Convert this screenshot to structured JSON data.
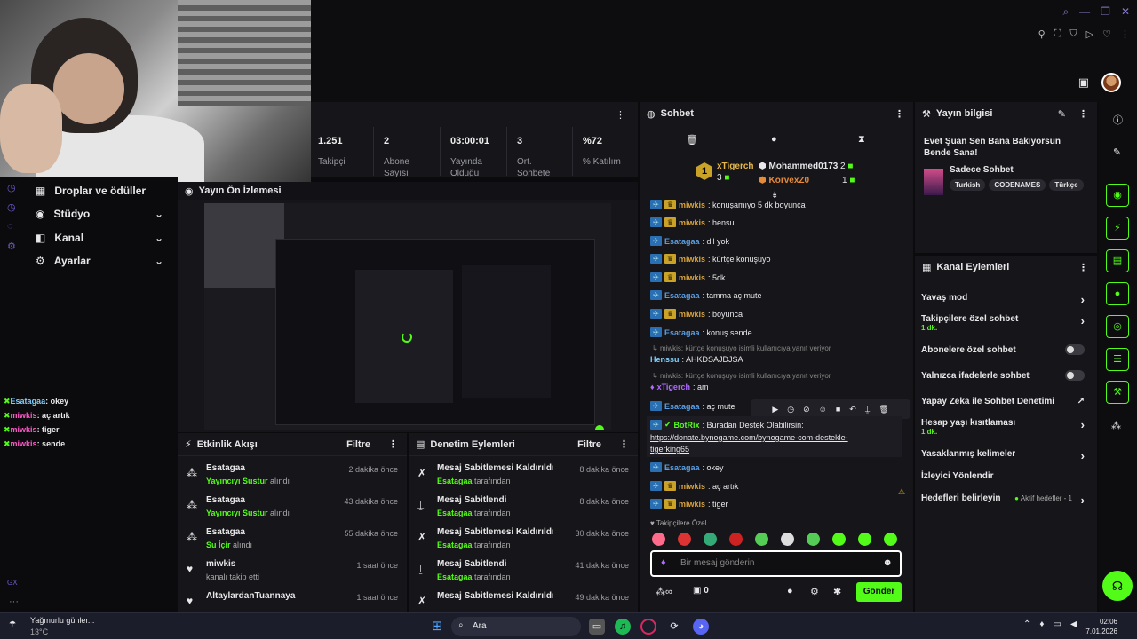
{
  "stats": [
    {
      "value": "1.251",
      "label": "Takipçi"
    },
    {
      "value": "2",
      "label": "Abone Sayısı"
    },
    {
      "value": "03:00:01",
      "label": "Yayında Olduğu"
    },
    {
      "value": "3",
      "label": "Ort. Sohbete"
    },
    {
      "value": "%72",
      "label": "% Katılım"
    }
  ],
  "nav": [
    {
      "label": "Droplar ve ödüller"
    },
    {
      "label": "Stüdyo"
    },
    {
      "label": "Kanal"
    },
    {
      "label": "Ayarlar"
    }
  ],
  "overlay_chat": [
    {
      "user": "Esatagaa",
      "text": ": okey"
    },
    {
      "user": "miwkis",
      "text": ": aç artık"
    },
    {
      "user": "miwkis",
      "text": ": tiger"
    },
    {
      "user": "miwkis",
      "text": ": sende"
    }
  ],
  "preview": {
    "title": "Yayın Ön İzlemesi"
  },
  "activity": {
    "title": "Etkinlik Akışı",
    "filter": "Filtre",
    "items": [
      {
        "user": "Esatagaa",
        "action_hl": "Yayıncıyı Sustur",
        "action": " alındı",
        "time": "2 dakika önce"
      },
      {
        "user": "Esatagaa",
        "action_hl": "Yayıncıyı Sustur",
        "action": " alındı",
        "time": "43 dakika önce"
      },
      {
        "user": "Esatagaa",
        "action_hl": "Su İçir",
        "action": " alındı",
        "time": "55 dakika önce"
      },
      {
        "user": "miwkis",
        "action_hl": "",
        "action": "kanalı takip etti",
        "time": "1 saat önce"
      },
      {
        "user": "AltaylardanTuannaya",
        "action_hl": "",
        "action": "",
        "time": "1 saat önce"
      }
    ]
  },
  "moderation": {
    "title": "Denetim Eylemleri",
    "filter": "Filtre",
    "items": [
      {
        "title": "Mesaj Sabitlemesi Kaldırıldı",
        "by": "Esatagaa",
        "suffix": " tarafından",
        "time": "8 dakika önce"
      },
      {
        "title": "Mesaj Sabitlendi",
        "by": "Esatagaa",
        "suffix": " tarafından",
        "time": "8 dakika önce"
      },
      {
        "title": "Mesaj Sabitlemesi Kaldırıldı",
        "by": "Esatagaa",
        "suffix": " tarafından",
        "time": "30 dakika önce"
      },
      {
        "title": "Mesaj Sabitlendi",
        "by": "Esatagaa",
        "suffix": " tarafından",
        "time": "41 dakika önce"
      },
      {
        "title": "Mesaj Sabitlemesi Kaldırıldı",
        "by": "",
        "suffix": "",
        "time": "49 dakika önce"
      }
    ]
  },
  "chat": {
    "title": "Sohbet",
    "leaders": {
      "first": "xTigerch",
      "first_count": "3",
      "second": "Mohammed0173",
      "second_count": "2",
      "third": "KorvexZ0",
      "third_count": "1",
      "rank": "1"
    },
    "messages": [
      {
        "user": "miwkis",
        "text": ": konuşamıyo 5 dk boyunca"
      },
      {
        "user": "miwkis",
        "text": ": hensu"
      },
      {
        "user": "Esatagaa",
        "text": ": dil yok"
      },
      {
        "user": "miwkis",
        "text": ": kürtçe konuşuyo"
      },
      {
        "user": "miwkis",
        "text": ": 5dk"
      },
      {
        "user": "Esatagaa",
        "text": ": tamma aç mute"
      },
      {
        "user": "miwkis",
        "text": ": boyunca"
      },
      {
        "user": "Esatagaa",
        "text": ": konuş sende"
      }
    ],
    "reply1": "miwkis: kürtçe konuşuyo isimli kullanıcıya yanıt veriyor",
    "reply1_user": "Henssu",
    "reply1_text": ": AHKDSAJDJSA",
    "reply2": "miwkis: kürtçe konuşuyo isimli kullanıcıya yanıt veriyor",
    "reply2_user": "xTigerch",
    "reply2_text": ": am",
    "mute_user": "Esatagaa",
    "mute_text": ": aç mute",
    "bot_user": "BotRix",
    "bot_text": ": Buradan Destek Olabilirsin:",
    "bot_link1": "https://donate.bynogame.com/bynogame-com-destekle-",
    "bot_link2": "tigerking65",
    "tail": [
      {
        "user": "Esatagaa",
        "text": ": okey"
      },
      {
        "user": "miwkis",
        "text": ": aç artık"
      },
      {
        "user": "miwkis",
        "text": ": tiger"
      }
    ],
    "followers_label": "Takipçilere Özel",
    "placeholder": "Bir mesaj gönderin",
    "points": "0",
    "send": "Gönder"
  },
  "info": {
    "title": "Yayın bilgisi",
    "stream_title": "Evet Şuan Sen Bana Bakıyorsun Bende Sana!",
    "category": "Sadece Sohbet",
    "tags": [
      "Turkish",
      "CODENAMES",
      "Türkçe"
    ]
  },
  "actions": {
    "title": "Kanal Eylemleri",
    "items": [
      {
        "label": "Yavaş mod",
        "sub": ""
      },
      {
        "label": "Takipçilere özel sohbet",
        "sub": "1 dk."
      },
      {
        "label": "Abonelere özel sohbet",
        "sub": ""
      },
      {
        "label": "Yalnızca ifadelerle sohbet",
        "sub": ""
      },
      {
        "label": "Yapay Zeka ile Sohbet Denetimi",
        "sub": ""
      },
      {
        "label": "Hesap yaşı kısıtlaması",
        "sub": "1 dk."
      },
      {
        "label": "Yasaklanmış kelimeler",
        "sub": ""
      },
      {
        "label": "İzleyici Yönlendir",
        "sub": ""
      },
      {
        "label": "Hedefleri belirleyin",
        "sub": ""
      }
    ],
    "goals_status": "Aktif hedefler - 1"
  },
  "taskbar": {
    "weather_title": "Yağmurlu günler...",
    "weather_temp": "13°C",
    "search": "Ara",
    "time": "02:06",
    "date": "7.01.2026"
  },
  "colors": {
    "accent": "#53fc18",
    "bg": "#0b0b0e",
    "panel": "#16161a"
  }
}
